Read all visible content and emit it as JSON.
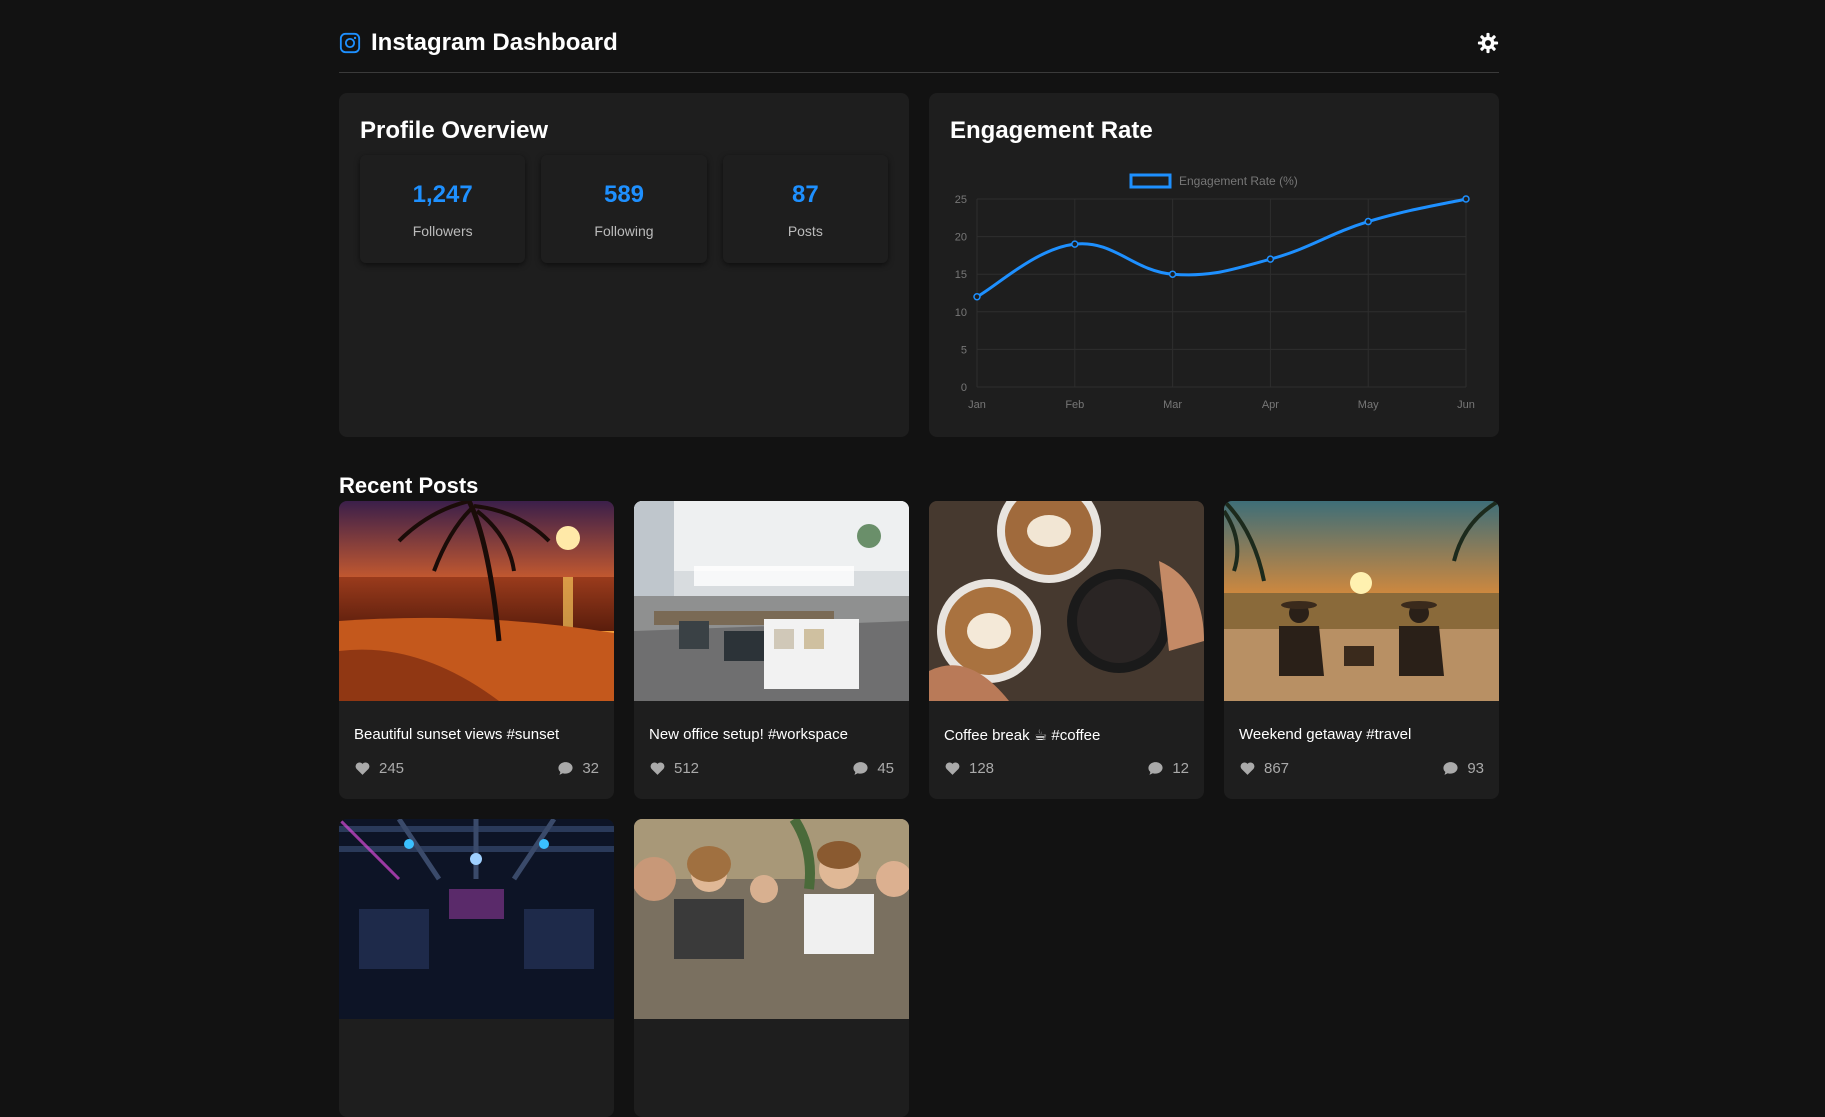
{
  "header": {
    "title": "Instagram Dashboard",
    "brand_icon": "instagram-icon",
    "settings_icon": "gear-icon",
    "accent": "#1e90ff"
  },
  "profile": {
    "title": "Profile Overview",
    "stats": [
      {
        "value": "1,247",
        "label": "Followers"
      },
      {
        "value": "589",
        "label": "Following"
      },
      {
        "value": "87",
        "label": "Posts"
      }
    ]
  },
  "engagement": {
    "title": "Engagement Rate"
  },
  "chart_data": {
    "type": "line",
    "categories": [
      "Jan",
      "Feb",
      "Mar",
      "Apr",
      "May",
      "Jun"
    ],
    "series": [
      {
        "name": "Engagement Rate (%)",
        "values": [
          12,
          19,
          15,
          17,
          22,
          25
        ],
        "color": "#1e90ff"
      }
    ],
    "ylim": [
      0,
      25
    ],
    "yticks": [
      "0",
      "5",
      "10",
      "15",
      "20",
      "25"
    ],
    "grid": true,
    "legend": "top-center",
    "smooth": true
  },
  "recent": {
    "title": "Recent Posts",
    "posts": [
      {
        "caption": "Beautiful sunset views #sunset",
        "likes": "245",
        "comments": "32",
        "image": "sunset-beach-photo"
      },
      {
        "caption": "New office setup! #workspace",
        "likes": "512",
        "comments": "45",
        "image": "office-photo"
      },
      {
        "caption": "Coffee break ☕ #coffee",
        "likes": "128",
        "comments": "12",
        "image": "coffee-photo"
      },
      {
        "caption": "Weekend getaway #travel",
        "likes": "867",
        "comments": "93",
        "image": "beach-getaway-photo"
      },
      {
        "caption": "",
        "likes": "",
        "comments": "",
        "image": "event-stage-photo"
      },
      {
        "caption": "",
        "likes": "",
        "comments": "",
        "image": "group-photo"
      }
    ]
  }
}
